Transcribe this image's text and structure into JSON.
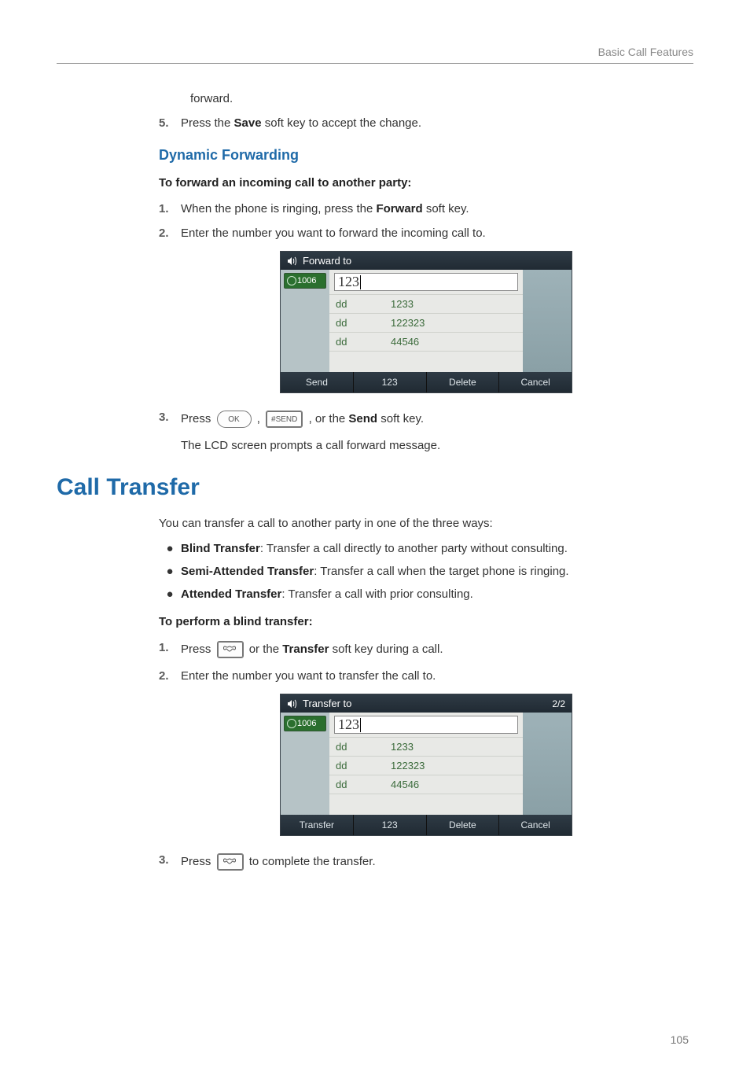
{
  "running_head": "Basic Call Features",
  "page_number": "105",
  "sec1": {
    "cont_para": "forward.",
    "step5_num": "5.",
    "step5_a": "Press the ",
    "step5_b": "Save",
    "step5_c": " soft key to accept the change.",
    "heading": "Dynamic Forwarding",
    "lead": "To forward an incoming call to another party:",
    "s1_num": "1.",
    "s1_a": "When the phone is ringing, press the ",
    "s1_b": "Forward",
    "s1_c": " soft key.",
    "s2_num": "2.",
    "s2_txt": "Enter the number you want to forward the incoming call to.",
    "s3_num": "3.",
    "s3_a": "Press ",
    "s3_b": " , ",
    "s3_c": " , or the ",
    "s3_d": "Send",
    "s3_e": " soft key.",
    "s3_follow": "The LCD screen prompts a call forward message.",
    "key_ok": "OK",
    "key_hash": "#SEND"
  },
  "sec2": {
    "heading": "Call Transfer",
    "intro": "You can transfer a call to another party in one of the three ways:",
    "b1_h": "Blind Transfer",
    "b1_t": ": Transfer a call directly to another party without consulting.",
    "b2_h": "Semi-Attended Transfer",
    "b2_t": ": Transfer a call when the target phone is ringing.",
    "b3_h": "Attended Transfer",
    "b3_t": ": Transfer a call with prior consulting.",
    "lead": "To perform a blind transfer:",
    "s1_num": "1.",
    "s1_a": "Press ",
    "s1_b": " or the ",
    "s1_c": "Transfer",
    "s1_d": " soft key during a call.",
    "s2_num": "2.",
    "s2_txt": "Enter the number you want to transfer the call to.",
    "s3_num": "3.",
    "s3_a": "Press ",
    "s3_b": " to complete the transfer."
  },
  "shot1": {
    "title": "Forward to",
    "tab": "1006",
    "input": "123",
    "rows": [
      {
        "c1": "dd",
        "c2": "1233"
      },
      {
        "c1": "dd",
        "c2": "122323"
      },
      {
        "c1": "dd",
        "c2": "44546"
      }
    ],
    "soft": [
      "Send",
      "123",
      "Delete",
      "Cancel"
    ]
  },
  "shot2": {
    "title": "Transfer to",
    "count": "2/2",
    "tab": "1006",
    "input": "123",
    "rows": [
      {
        "c1": "dd",
        "c2": "1233"
      },
      {
        "c1": "dd",
        "c2": "122323"
      },
      {
        "c1": "dd",
        "c2": "44546"
      }
    ],
    "soft": [
      "Transfer",
      "123",
      "Delete",
      "Cancel"
    ]
  },
  "bullet": "●"
}
